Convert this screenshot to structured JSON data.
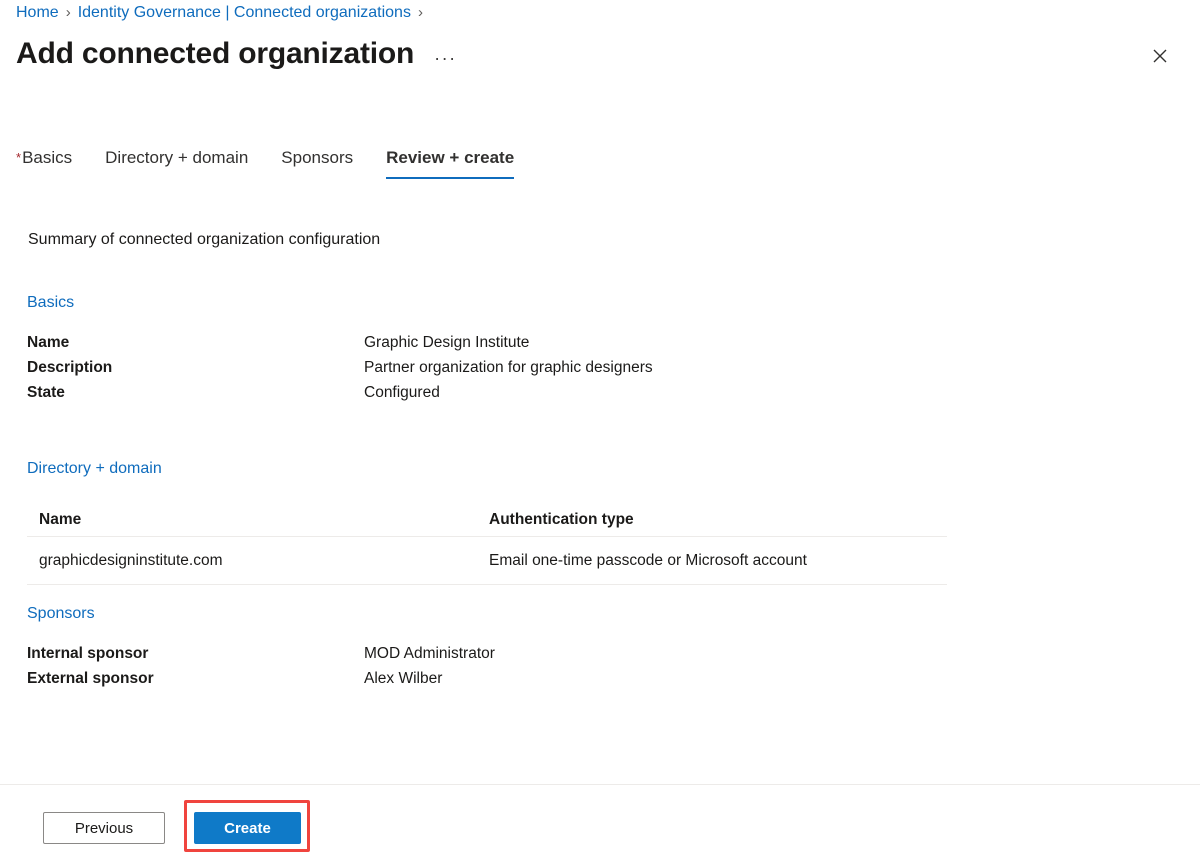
{
  "breadcrumb": {
    "items": [
      {
        "label": "Home",
        "type": "link"
      },
      {
        "label": "Identity Governance | Connected organizations",
        "type": "link"
      }
    ],
    "separator": "›"
  },
  "header": {
    "title": "Add connected organization",
    "more_menu": "···",
    "close_icon": "close-icon"
  },
  "tabs": [
    {
      "label": "Basics",
      "required": true,
      "active": false
    },
    {
      "label": "Directory + domain",
      "required": false,
      "active": false
    },
    {
      "label": "Sponsors",
      "required": false,
      "active": false
    },
    {
      "label": "Review + create",
      "required": false,
      "active": true
    }
  ],
  "main": {
    "summary_text": "Summary of connected organization configuration",
    "sections": {
      "basics": {
        "heading": "Basics",
        "rows": [
          {
            "key": "Name",
            "value": "Graphic Design Institute"
          },
          {
            "key": "Description",
            "value": "Partner organization for graphic designers"
          },
          {
            "key": "State",
            "value": "Configured"
          }
        ]
      },
      "directory_domain": {
        "heading": "Directory + domain",
        "columns": [
          "Name",
          "Authentication type"
        ],
        "rows": [
          {
            "name": "graphicdesigninstitute.com",
            "authentication_type": "Email one-time passcode or Microsoft account"
          }
        ]
      },
      "sponsors": {
        "heading": "Sponsors",
        "rows": [
          {
            "key": "Internal sponsor",
            "value": "MOD Administrator"
          },
          {
            "key": "External sponsor",
            "value": "Alex Wilber"
          }
        ]
      }
    }
  },
  "footer": {
    "previous_label": "Previous",
    "create_label": "Create"
  },
  "colors": {
    "link_blue": "#0f6cbd",
    "primary_button": "#0f7ac8",
    "required_asterisk": "#a4262c",
    "highlight_red": "#f0443e",
    "divider": "#edebe9"
  }
}
